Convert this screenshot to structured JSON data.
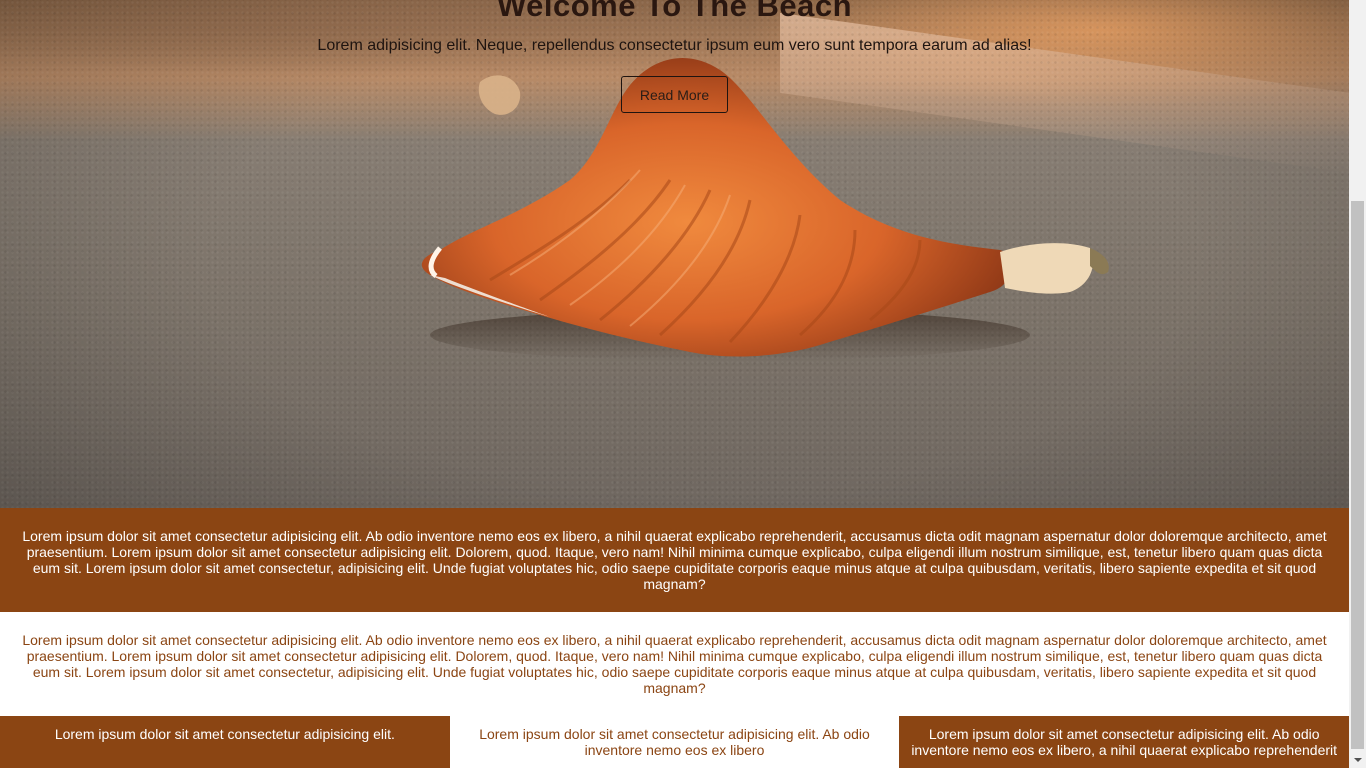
{
  "hero": {
    "title": "Welcome To The Beach",
    "subtitle": "Lorem adipisicing elit. Neque, repellendus consectetur ipsum eum vero sunt tempora earum ad alias!",
    "button_label": "Read More"
  },
  "sections": {
    "brown_text": "Lorem ipsum dolor sit amet consectetur adipisicing elit. Ab odio inventore nemo eos ex libero, a nihil quaerat explicabo reprehenderit, accusamus dicta odit magnam aspernatur dolor doloremque architecto, amet praesentium. Lorem ipsum dolor sit amet consectetur adipisicing elit. Dolorem, quod. Itaque, vero nam! Nihil minima cumque explicabo, culpa eligendi illum nostrum similique, est, tenetur libero quam quas dicta eum sit. Lorem ipsum dolor sit amet consectetur, adipisicing elit. Unde fugiat voluptates hic, odio saepe cupiditate corporis eaque minus atque at culpa quibusdam, veritatis, libero sapiente expedita et sit quod magnam?",
    "white_text": "Lorem ipsum dolor sit amet consectetur adipisicing elit. Ab odio inventore nemo eos ex libero, a nihil quaerat explicabo reprehenderit, accusamus dicta odit magnam aspernatur dolor doloremque architecto, amet praesentium. Lorem ipsum dolor sit amet consectetur adipisicing elit. Dolorem, quod. Itaque, vero nam! Nihil minima cumque explicabo, culpa eligendi illum nostrum similique, est, tenetur libero quam quas dicta eum sit. Lorem ipsum dolor sit amet consectetur, adipisicing elit. Unde fugiat voluptates hic, odio saepe cupiditate corporis eaque minus atque at culpa quibusdam, veritatis, libero sapiente expedita et sit quod magnam?"
  },
  "columns": [
    {
      "text": "Lorem ipsum dolor sit amet consectetur adipisicing elit."
    },
    {
      "text": "Lorem ipsum dolor sit amet consectetur adipisicing elit. Ab odio inventore nemo eos ex libero"
    },
    {
      "text": "Lorem ipsum dolor sit amet consectetur adipisicing elit. Ab odio inventore nemo eos ex libero, a nihil quaerat explicabo reprehenderit"
    }
  ],
  "colors": {
    "brand_brown": "#8b4513",
    "white": "#ffffff"
  },
  "icons": {
    "scroll_down": "chevron-down-icon"
  }
}
